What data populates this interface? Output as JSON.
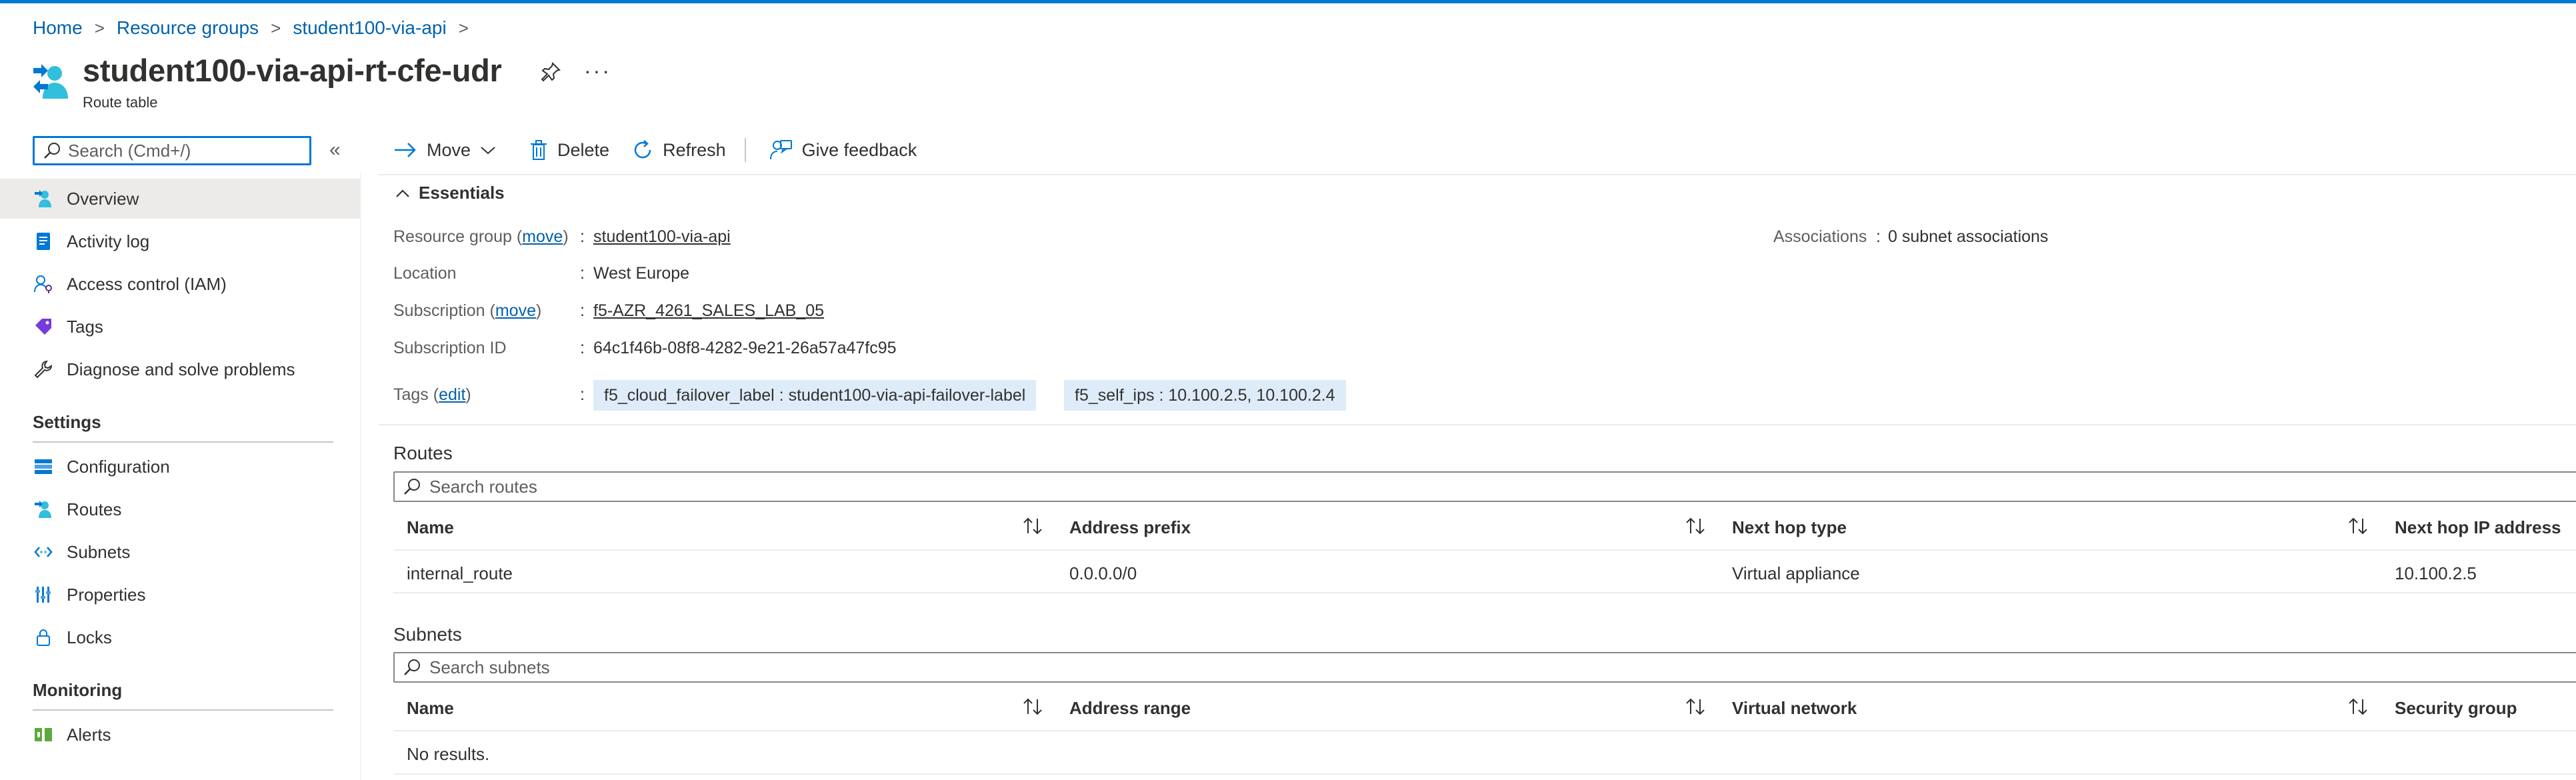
{
  "breadcrumb": {
    "items": [
      "Home",
      "Resource groups",
      "student100-via-api"
    ],
    "separator": ">"
  },
  "header": {
    "title": "student100-via-api-rt-cfe-udr",
    "subtitle": "Route table",
    "more_label": "···"
  },
  "sidebar": {
    "search_placeholder": "Search (Cmd+/)",
    "collapse_label": "«",
    "top_items": [
      {
        "label": "Overview",
        "icon": "overview-icon",
        "selected": true
      },
      {
        "label": "Activity log",
        "icon": "activity-log-icon"
      },
      {
        "label": "Access control (IAM)",
        "icon": "iam-icon"
      },
      {
        "label": "Tags",
        "icon": "tag-icon"
      },
      {
        "label": "Diagnose and solve problems",
        "icon": "wrench-icon"
      }
    ],
    "settings_header": "Settings",
    "settings_items": [
      {
        "label": "Configuration",
        "icon": "configuration-icon"
      },
      {
        "label": "Routes",
        "icon": "routes-icon"
      },
      {
        "label": "Subnets",
        "icon": "subnets-icon"
      },
      {
        "label": "Properties",
        "icon": "properties-icon"
      },
      {
        "label": "Locks",
        "icon": "lock-icon"
      }
    ],
    "monitoring_header": "Monitoring",
    "monitoring_items": [
      {
        "label": "Alerts",
        "icon": "alerts-icon"
      }
    ]
  },
  "toolbar": {
    "move_label": "Move",
    "delete_label": "Delete",
    "refresh_label": "Refresh",
    "feedback_label": "Give feedback"
  },
  "essentials": {
    "toggle_label": "Essentials",
    "resource_group": {
      "label": "Resource group",
      "action": "move",
      "value": "student100-via-api"
    },
    "location": {
      "label": "Location",
      "value": "West Europe"
    },
    "subscription": {
      "label": "Subscription",
      "action": "move",
      "value": "f5-AZR_4261_SALES_LAB_05"
    },
    "subscription_id": {
      "label": "Subscription ID",
      "value": "64c1f46b-08f8-4282-9e21-26a57a47fc95"
    },
    "tags": {
      "label": "Tags",
      "action": "edit",
      "items": [
        "f5_cloud_failover_label : student100-via-api-failover-label",
        "f5_self_ips : 10.100.2.5, 10.100.2.4"
      ]
    },
    "associations": {
      "label": "Associations",
      "value": "0 subnet associations"
    }
  },
  "routes": {
    "title": "Routes",
    "search_placeholder": "Search routes",
    "columns": [
      "Name",
      "Address prefix",
      "Next hop type",
      "Next hop IP address"
    ],
    "rows": [
      [
        "internal_route",
        "0.0.0.0/0",
        "Virtual appliance",
        "10.100.2.5"
      ]
    ]
  },
  "subnets": {
    "title": "Subnets",
    "search_placeholder": "Search subnets",
    "columns": [
      "Name",
      "Address range",
      "Virtual network",
      "Security group"
    ],
    "empty_text": "No results."
  },
  "colors": {
    "accent": "#0078d4",
    "link": "#0062ad",
    "tag_chip": "#deecf9",
    "selected_nav": "#edebe9"
  }
}
